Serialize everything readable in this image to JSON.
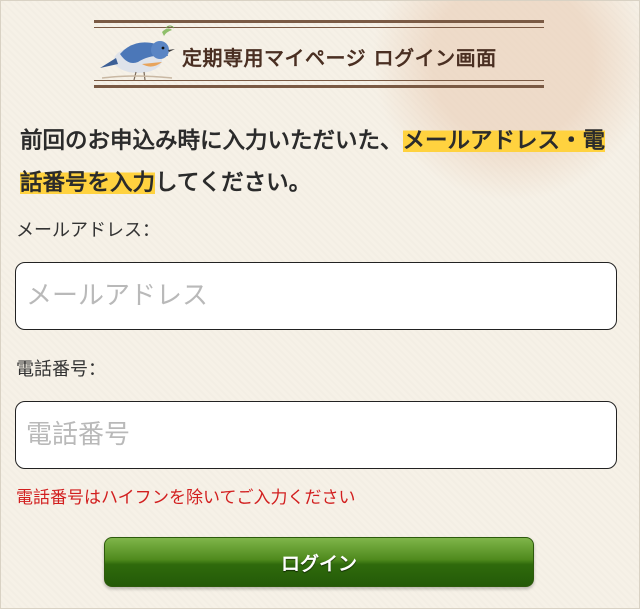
{
  "header": {
    "title": "定期専用マイページ ログイン画面"
  },
  "intro": {
    "text_before": "前回のお申込み時に入力いただいた、",
    "highlight": "メールアドレス・電話番号を入力",
    "text_after": "してください。"
  },
  "form": {
    "email": {
      "label": "メールアドレス：",
      "placeholder": "メールアドレス",
      "value": ""
    },
    "phone": {
      "label": "電話番号：",
      "placeholder": "電話番号",
      "value": ""
    },
    "phone_note": "電話番号はハイフンを除いてご入力ください",
    "login_label": "ログイン"
  },
  "colors": {
    "highlight": "#ffd23f",
    "note_red": "#d21f1f",
    "button_green": "#3f7a14",
    "banner_brown": "#4a2f22"
  }
}
